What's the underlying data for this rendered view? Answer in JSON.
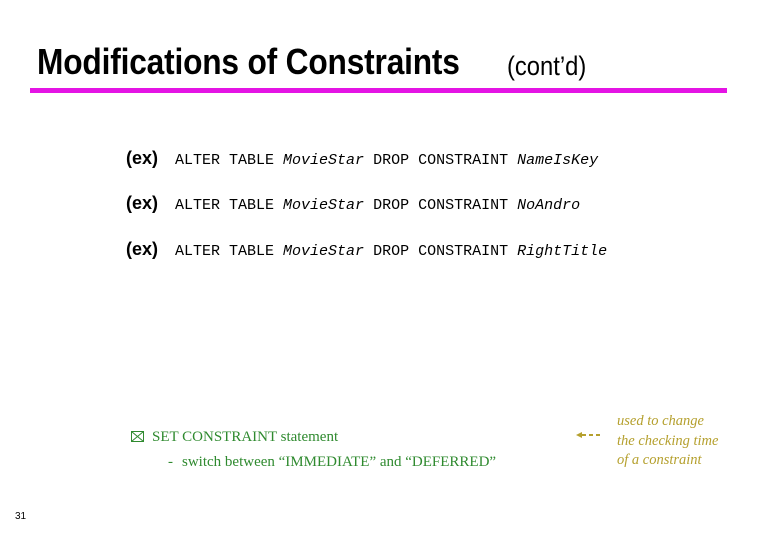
{
  "slide": {
    "title": "Modifications of Constraints",
    "title_suffix": "(cont’d)",
    "accent_color": "#e414e4",
    "page_number": "31"
  },
  "examples": [
    {
      "prefix": "(ex)",
      "command": "ALTER TABLE",
      "table": "MovieStar",
      "action": "DROP CONSTRAINT",
      "constraint": "NameIsKey"
    },
    {
      "prefix": "(ex)",
      "command": "ALTER TABLE",
      "table": "MovieStar",
      "action": "DROP CONSTRAINT",
      "constraint": "NoAndro"
    },
    {
      "prefix": "(ex)",
      "command": "ALTER TABLE",
      "table": "MovieStar",
      "action": "DROP CONSTRAINT",
      "constraint": "RightTitle"
    }
  ],
  "bullet": {
    "icon": "ballot-box-x-icon",
    "text": "SET CONSTRAINT statement",
    "color": "#2f8a2f",
    "sub_items": [
      {
        "marker": "-",
        "text": "switch between “IMMEDIATE” and “DEFERRED”"
      }
    ]
  },
  "annotation": {
    "icon": "dashed-left-arrow-icon",
    "color": "#b5a02e",
    "lines": [
      "used to change",
      "the checking time",
      "of a constraint"
    ]
  }
}
